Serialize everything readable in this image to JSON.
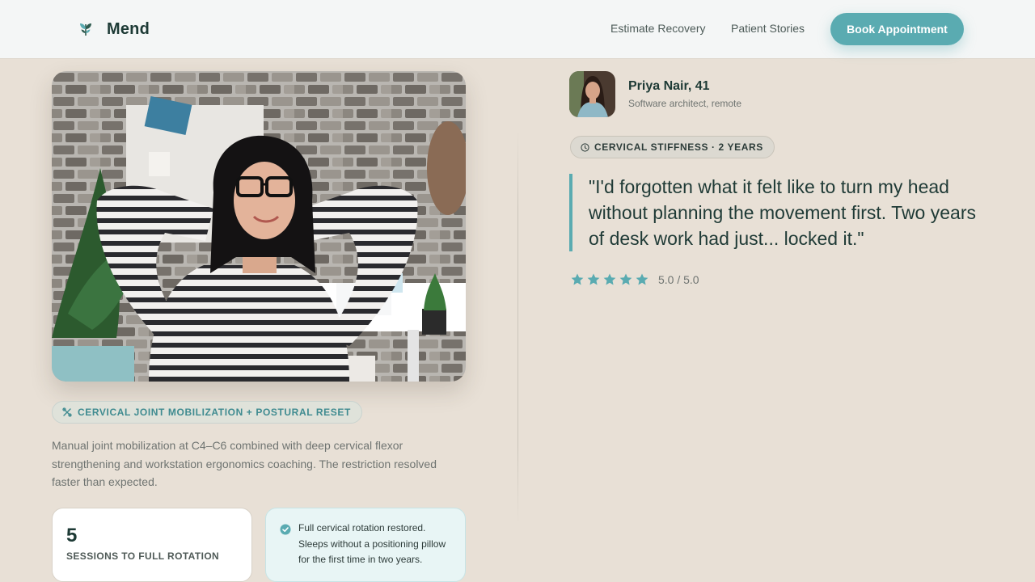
{
  "header": {
    "brand": "Mend",
    "nav": {
      "estimate": "Estimate Recovery",
      "stories": "Patient Stories"
    },
    "cta": "Book Appointment"
  },
  "case": {
    "treatment_tag": "Cervical Joint Mobilization + Postural Reset",
    "description": "Manual joint mobilization at C4–C6 combined with deep cervical flexor strengthening and workstation ergonomics coaching. The restriction resolved faster than expected.",
    "stat": {
      "value": "5",
      "label": "SESSIONS TO FULL ROTATION"
    },
    "outcome": "Full cervical rotation restored. Sleeps without a positioning pillow for the first time in two years."
  },
  "patient": {
    "name": "Priya Nair, 41",
    "role": "Software architect, remote",
    "condition_tag": "Cervical Stiffness · 2 Years",
    "quote": "\"I'd forgotten what it felt like to turn my head without planning the movement first. Two years of desk work had just... locked it.\"",
    "rating": {
      "stars": 5,
      "text": "5.0 / 5.0"
    }
  },
  "colors": {
    "accent": "#5aabb1",
    "page_bg": "#e8e0d6",
    "heading": "#1d3a35",
    "star": "#5aabb1"
  },
  "icons": {
    "logo": "leaf-logo-icon",
    "treatment": "tools-icon",
    "condition": "clock-icon",
    "outcome": "check-circle-icon",
    "rating": "star-icon"
  }
}
